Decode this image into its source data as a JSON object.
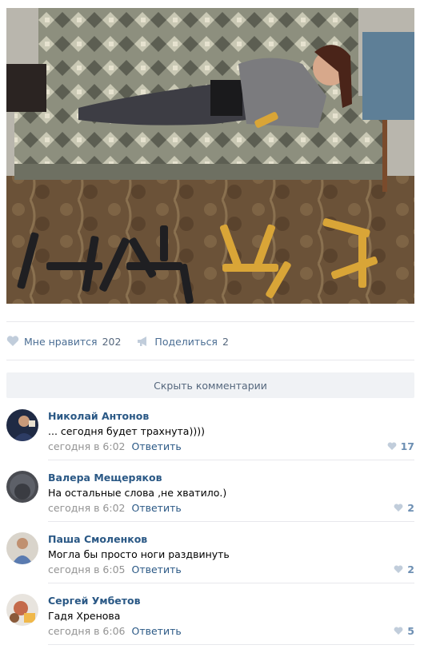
{
  "post": {
    "likes_label": "Мне нравится",
    "likes_count": "202",
    "share_label": "Поделиться",
    "share_count": "2",
    "hide_comments_label": "Скрыть комментарии"
  },
  "icons": {
    "like": "heart-icon",
    "share": "megaphone-icon"
  },
  "colors": {
    "link": "#2a5885",
    "muted": "#939393",
    "action": "#4a6d93",
    "bar": "#f0f2f5"
  },
  "comments": [
    {
      "author": "Николай Антонов",
      "text": "... сегодня будет трахнута))))",
      "time": "сегодня в 6:02",
      "reply": "Ответить",
      "likes": "17"
    },
    {
      "author": "Валера Мещеряков",
      "text": "На остальные слова ,не хватило.)",
      "time": "сегодня в 6:02",
      "reply": "Ответить",
      "likes": "2"
    },
    {
      "author": "Паша Смоленков",
      "text": "Могла бы просто ноги раздвинуть",
      "time": "сегодня в 6:05",
      "reply": "Ответить",
      "likes": "2"
    },
    {
      "author": "Сергей Умбетов",
      "text": "Гадя Хренова",
      "time": "сегодня в 6:06",
      "reply": "Ответить",
      "likes": "5"
    }
  ]
}
